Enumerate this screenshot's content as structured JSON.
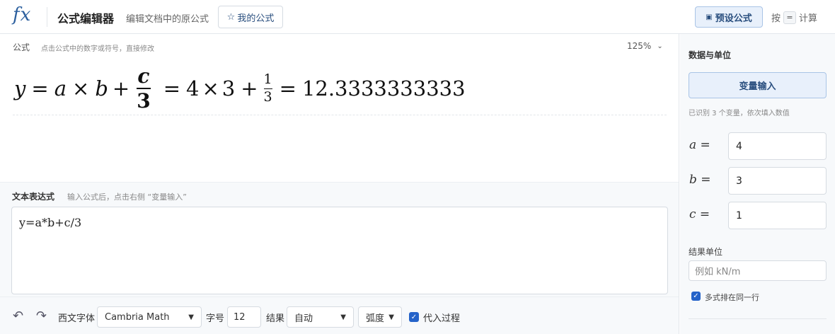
{
  "header": {
    "logo": "fx",
    "title": "公式编辑器",
    "subtitle": "编辑文档中的原公式",
    "my_formula_label": "我的公式",
    "preset_label": "预设公式",
    "hint_prefix": "按",
    "hint_key": "=",
    "hint_suffix": "计算"
  },
  "formula": {
    "label": "公式",
    "hint": "点击公式中的数字或符号，直接修改",
    "zoom": "125%",
    "lhs_var": "y",
    "eq1": "=",
    "var_a": "a",
    "times1": "×",
    "var_b": "b",
    "plus1": "+",
    "frac1_num": "c",
    "frac1_den": "3",
    "eq2": "=",
    "val_a": "4",
    "times2": "×",
    "val_b": "3",
    "plus2": "+",
    "frac2_num": "1",
    "frac2_den": "3",
    "eq3": "=",
    "result": "12.3333333333"
  },
  "text_expr": {
    "label": "文本表达式",
    "hint": "输入公式后，点击右侧 “变量输入”",
    "value": "y=a*b+c/3"
  },
  "toolbar": {
    "undo_icon": "undo-icon",
    "redo_icon": "redo-icon",
    "font_label": "西文字体",
    "font_value": "Cambria Math",
    "size_label": "字号",
    "size_value": "12",
    "result_label": "结果",
    "result_value": "自动",
    "angle_value": "弧度",
    "substitute_label": "代入过程",
    "substitute_checked": true
  },
  "side": {
    "title": "数据与单位",
    "var_input_label": "变量输入",
    "detected": "已识别 3 个变量，依次填入数值",
    "variables": [
      {
        "name": "a =",
        "value": "4"
      },
      {
        "name": "b =",
        "value": "3"
      },
      {
        "name": "c =",
        "value": "1"
      }
    ],
    "unit_label": "结果单位",
    "unit_placeholder": "例如 kN/m",
    "same_line_label": "多式排在同一行",
    "same_line_checked": true
  },
  "colors": {
    "accent": "#2563c9",
    "accent_light": "#e8f0fb",
    "brand": "#2b5f9e"
  }
}
